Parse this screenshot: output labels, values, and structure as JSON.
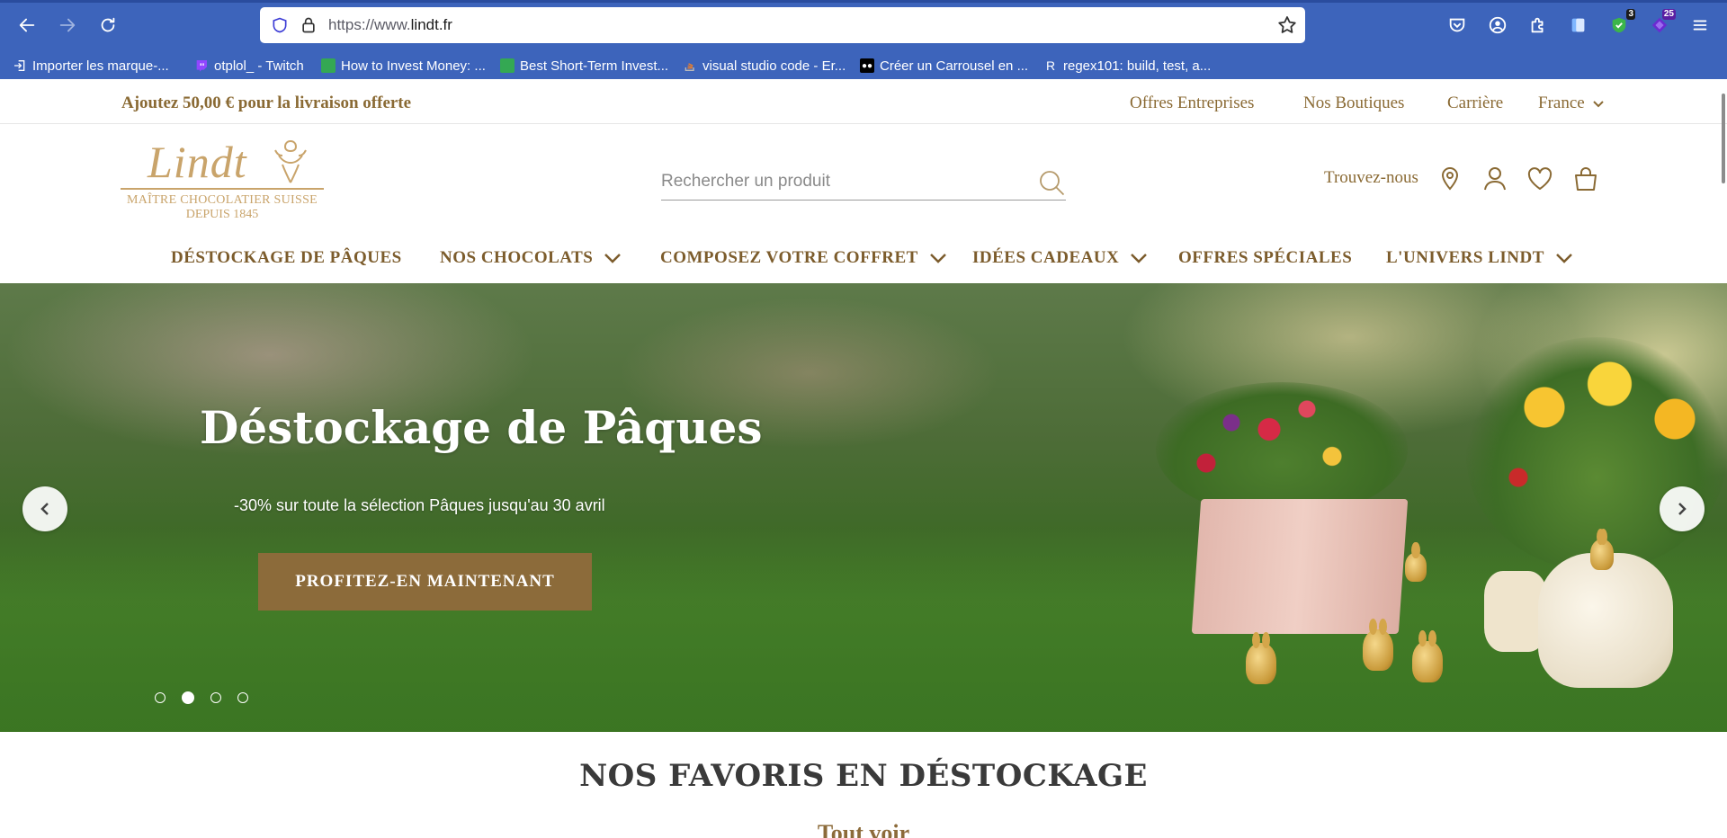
{
  "browser": {
    "url_prefix": "https://www.",
    "url_domain": "lindt.fr",
    "extension_badges": {
      "shield": "3",
      "purple": "25"
    },
    "bookmarks": [
      {
        "label": "Importer les marque-...",
        "color": "#ffffff"
      },
      {
        "label": "otplol_ - Twitch",
        "color": "#9146ff"
      },
      {
        "label": "How to Invest Money: ...",
        "color": "#34a853"
      },
      {
        "label": "Best Short-Term Invest...",
        "color": "#34a853"
      },
      {
        "label": "visual studio code - Er...",
        "color": "#f48024"
      },
      {
        "label": "Créer un Carrousel en ...",
        "color": "#000000"
      },
      {
        "label": "regex101: build, test, a...",
        "color": "#3d64bb"
      }
    ]
  },
  "topbar": {
    "promo": "Ajoutez 50,00 € pour la livraison offerte",
    "links": [
      "Offres Entreprises",
      "Nos Boutiques",
      "Carrière"
    ],
    "country": "France"
  },
  "header": {
    "logo": {
      "name": "Lindt",
      "line1": "MAÎTRE CHOCOLATIER SUISSE",
      "line2": "DEPUIS 1845"
    },
    "search_placeholder": "Rechercher un produit",
    "find_us": "Trouvez-nous"
  },
  "nav": {
    "items": [
      {
        "label": "DÉSTOCKAGE DE PÂQUES",
        "dropdown": false
      },
      {
        "label": "NOS CHOCOLATS",
        "dropdown": true
      },
      {
        "label": "COMPOSEZ VOTRE COFFRET",
        "dropdown": true
      },
      {
        "label": "IDÉES CADEAUX",
        "dropdown": true
      },
      {
        "label": "OFFRES SPÉCIALES",
        "dropdown": false
      },
      {
        "label": "L'UNIVERS LINDT",
        "dropdown": true
      }
    ]
  },
  "hero": {
    "title": "Déstockage de Pâques",
    "subtitle": "-30% sur toute la sélection Pâques jusqu'au 30 avril",
    "cta": "PROFITEZ-EN MAINTENANT",
    "slides": 4,
    "active_slide": 2
  },
  "section": {
    "title": "NOS FAVORIS EN DÉSTOCKAGE",
    "see_all": "Tout voir"
  },
  "colors": {
    "brand_gold": "#8a6a34",
    "cta_bg": "#8c6b3a",
    "browser_blue": "#3d64bb"
  }
}
